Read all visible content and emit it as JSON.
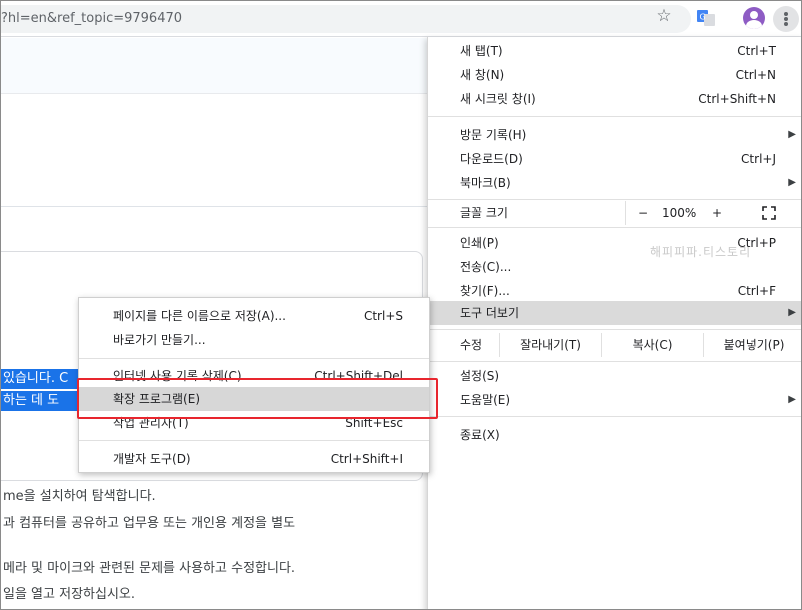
{
  "url": "?hl=en&ref_topic=9796470",
  "background": {
    "highlight_lines": [
      "있습니다. C",
      "하는 데 도"
    ],
    "text_lines": [
      "me을 설치하여 탐색합니다.",
      "과 컴퓨터를 공유하고 업무용 또는 개인용 계정을 별도",
      "메라 및 마이크와 관련된 문제를 사용하고 수정합니다.",
      "일을 열고 저장하십시오."
    ]
  },
  "main_menu": {
    "items": [
      {
        "label": "새 탭(T)",
        "shortcut": "Ctrl+T"
      },
      {
        "label": "새 창(N)",
        "shortcut": "Ctrl+N"
      },
      {
        "label": "새 시크릿 창(I)",
        "shortcut": "Ctrl+Shift+N"
      },
      {
        "label": "방문 기록(H)",
        "shortcut": ""
      },
      {
        "label": "다운로드(D)",
        "shortcut": "Ctrl+J"
      },
      {
        "label": "북마크(B)",
        "shortcut": ""
      },
      {
        "label": "인쇄(P)",
        "shortcut": "Ctrl+P"
      },
      {
        "label": "전송(C)...",
        "shortcut": ""
      },
      {
        "label": "찾기(F)...",
        "shortcut": "Ctrl+F"
      },
      {
        "label": "도구 더보기",
        "shortcut": ""
      },
      {
        "label": "설정(S)",
        "shortcut": ""
      },
      {
        "label": "도움말(E)",
        "shortcut": ""
      },
      {
        "label": "종료(X)",
        "shortcut": ""
      }
    ],
    "zoom": {
      "label": "글꼴 크기",
      "minus": "−",
      "value": "100%",
      "plus": "+"
    },
    "edit": {
      "label": "수정",
      "cut": "잘라내기(T)",
      "copy": "복사(C)",
      "paste": "붙여넣기(P)"
    },
    "watermark": "해피피파.티스토리"
  },
  "submenu": {
    "items": [
      {
        "label": "페이지를 다른 이름으로 저장(A)...",
        "shortcut": "Ctrl+S"
      },
      {
        "label": "바로가기 만들기...",
        "shortcut": ""
      },
      {
        "label": "인터넷 사용 기록 삭제(C)...",
        "shortcut": "Ctrl+Shift+Del"
      },
      {
        "label": "확장 프로그램(E)",
        "shortcut": ""
      },
      {
        "label": "작업 관리자(T)",
        "shortcut": "Shift+Esc"
      },
      {
        "label": "개발자 도구(D)",
        "shortcut": "Ctrl+Shift+I"
      }
    ]
  },
  "colors": {
    "accent": "#1a73e8",
    "highlight_box": "#e8262e",
    "avatar": "#8e5cc4"
  }
}
